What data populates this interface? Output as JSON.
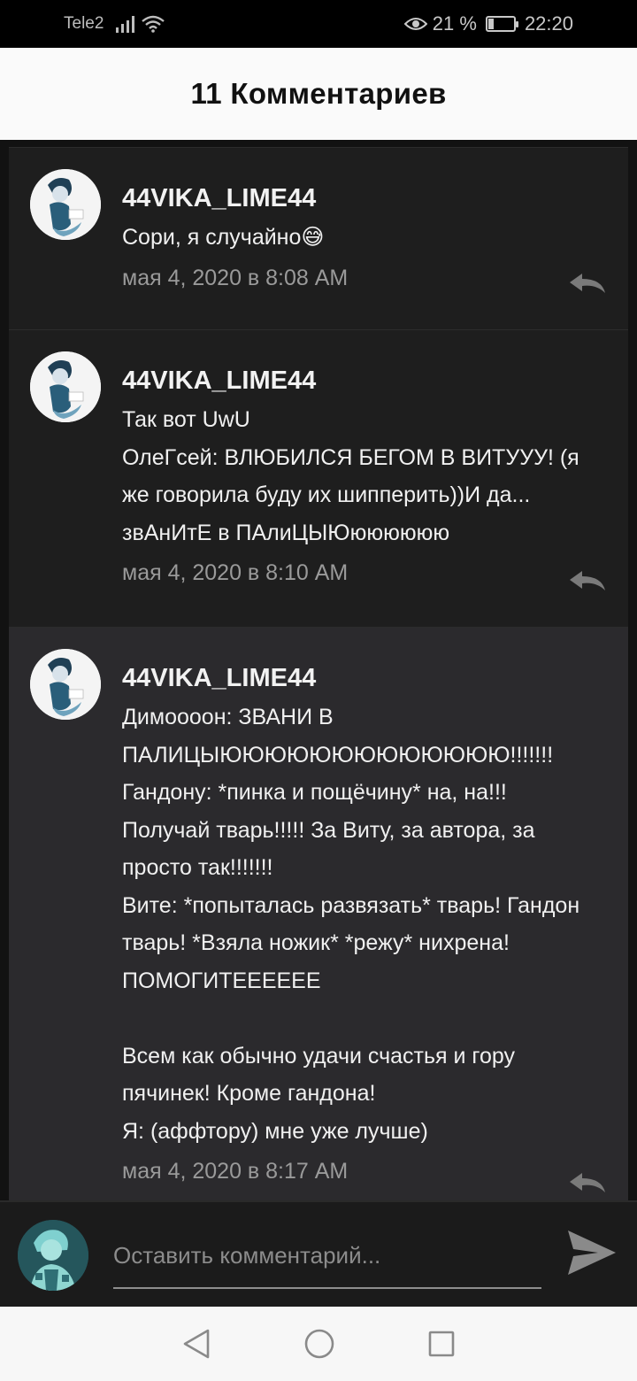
{
  "status_bar": {
    "carrier": "Tele2",
    "battery": "21 %",
    "battery_level": 0.21,
    "time": "22:20"
  },
  "header": {
    "title": "11 Комментариев"
  },
  "comments": [
    {
      "author": "44VIKA_LIME44",
      "text": "Сори, я случайно😅",
      "date": "мая 4, 2020 в 8:08 AM"
    },
    {
      "author": "44VIKA_LIME44",
      "text": "Так вот UwU\nОлеГсей: ВЛЮБИЛСЯ БЕГОМ В ВИТУУУ! (я же говорила буду их шипперить))И да...\nзвАнИтЕ в ПАлиЦЫЮюююююю",
      "date": "мая 4, 2020 в 8:10 AM"
    },
    {
      "author": "44VIKA_LIME44",
      "text": "Димоооон: ЗВАНИ В ПАЛИЦЫЮЮЮЮЮЮЮЮЮЮЮЮЮ!!!!!!!\nГандону: *пинка и пощёчину* на, на!!!\nПолучай тварь!!!!! За Виту, за автора, за просто так!!!!!!!\nВите: *попыталась развязать* тварь! Гандон тварь! *Взяла ножик* *режу* нихрена! ПОМОГИТЕЕЕЕЕЕ\n\nВсем как обычно удачи счастья и гору пячинек! Кроме гандона!\nЯ: (аффтору) мне уже лучше)",
      "date": "мая 4, 2020 в 8:17 AM"
    }
  ],
  "compose": {
    "placeholder": "Оставить комментарий..."
  },
  "icons": {
    "reply": "reply-arrow-icon",
    "send": "send-icon",
    "nav_back": "back-triangle-icon",
    "nav_home": "home-circle-icon",
    "nav_recents": "recents-square-icon"
  },
  "colors": {
    "background": "#121212",
    "comment_bg": "#1e1e1e",
    "highlight_bg": "#2b2a2d",
    "header_bg": "#fafafa"
  }
}
